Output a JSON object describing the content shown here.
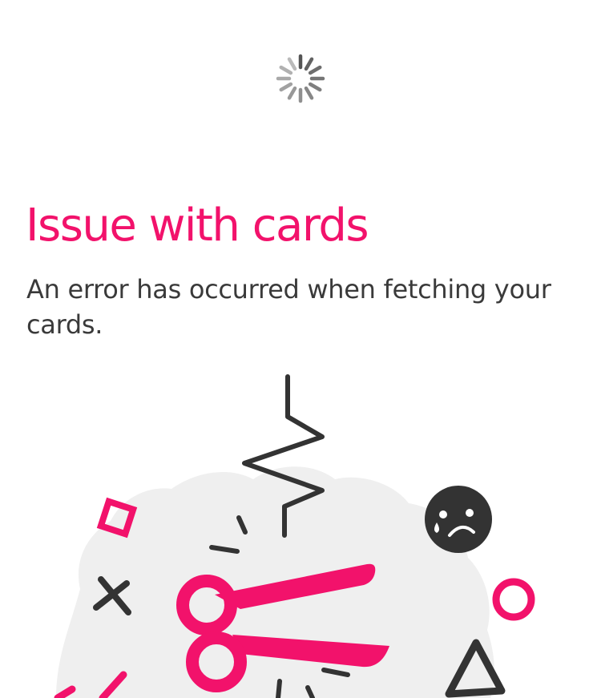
{
  "status": {
    "loading_icon": "spinner-icon"
  },
  "error": {
    "title": "Issue with cards",
    "message": "An error has occurred when fetching your cards."
  },
  "illustration": {
    "icon": "broken-scissors-illustration",
    "accent_color": "#f2126b",
    "dark_color": "#333333",
    "blob_color": "#efefef"
  },
  "colors": {
    "title": "#f2126b",
    "text": "#3a3a3a",
    "background": "#ffffff"
  }
}
